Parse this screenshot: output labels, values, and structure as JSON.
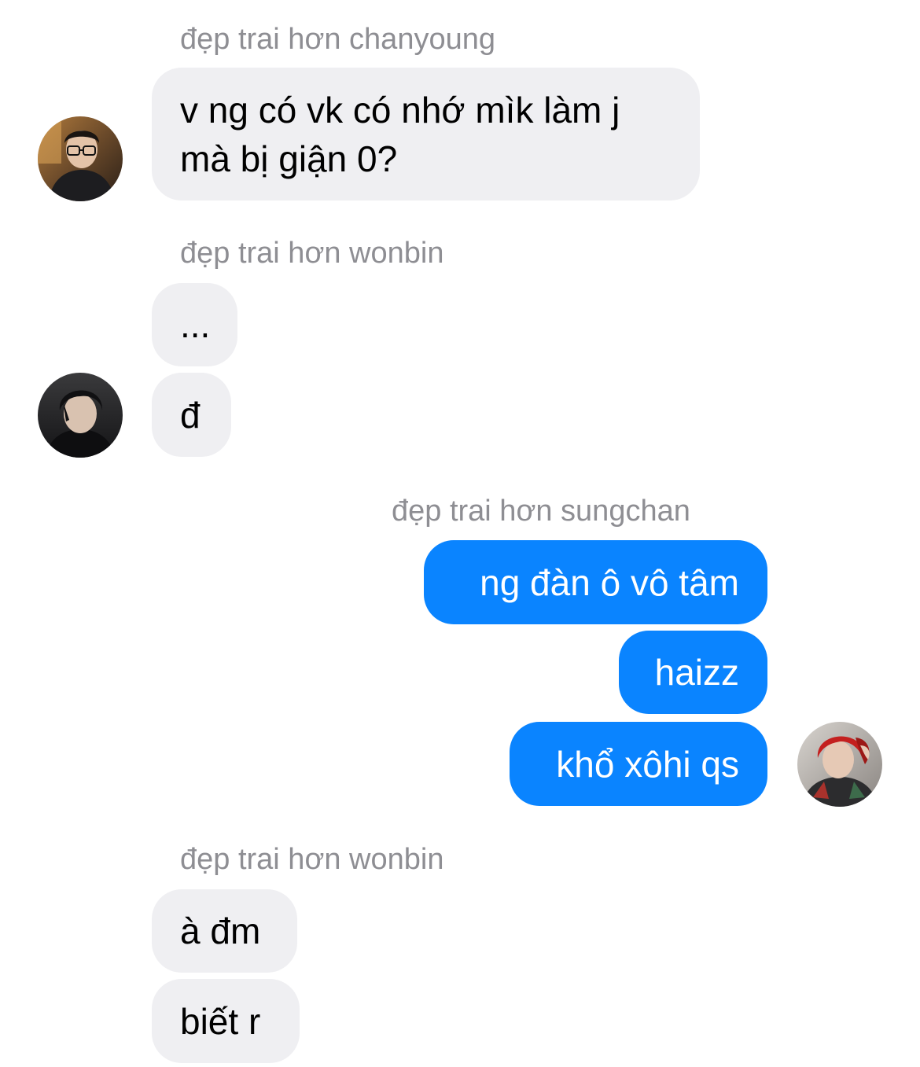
{
  "conversation": {
    "groups": [
      {
        "sender": "đẹp trai hơn chanyoung",
        "messages": [
          "v ng có vk có nhớ mìk làm j mà bị giận 0?"
        ]
      },
      {
        "sender": "đẹp trai hơn wonbin",
        "messages": [
          "...",
          "đ"
        ]
      },
      {
        "sender": "đẹp trai hơn sungchan",
        "messages": [
          "ng đàn ô vô tâm",
          "haizz",
          "khổ xôhi qs"
        ]
      },
      {
        "sender": "đẹp trai hơn wonbin",
        "messages": [
          "à đm",
          "biết r"
        ]
      }
    ]
  },
  "avatars": {
    "chanyoung": "avatar-photo-glasses",
    "wonbin": "avatar-photo-dark-hair",
    "sungchan": "avatar-photo-red-hair"
  },
  "colors": {
    "incoming_bubble": "#efeff2",
    "outgoing_bubble": "#0a84ff",
    "sender_name": "#8e8e93"
  }
}
